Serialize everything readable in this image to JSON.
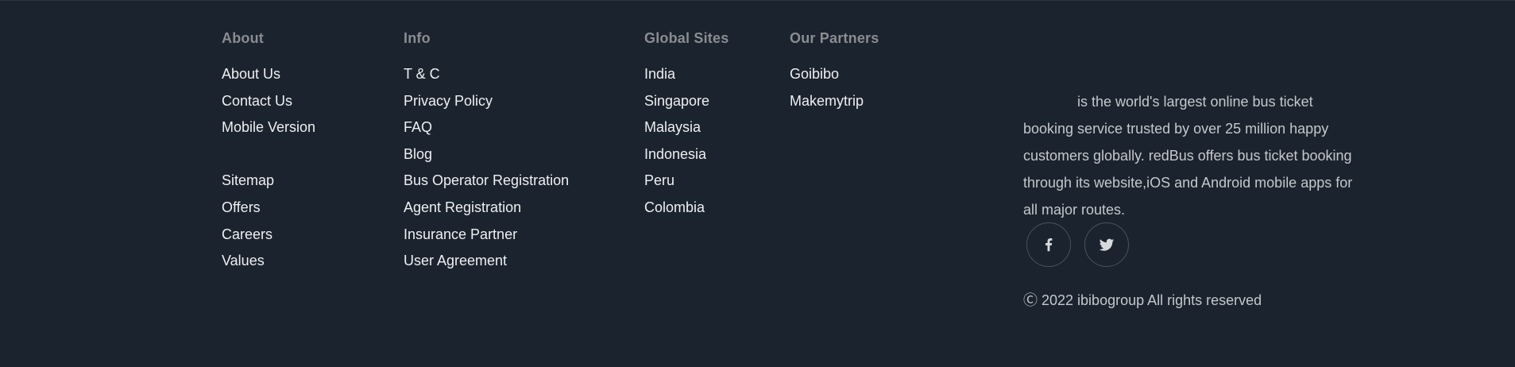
{
  "about": {
    "heading": "About",
    "items": [
      "About Us",
      "Contact Us",
      "Mobile Version",
      "",
      "Sitemap",
      "Offers",
      "Careers",
      "Values"
    ]
  },
  "info": {
    "heading": "Info",
    "items": [
      "T & C",
      "Privacy Policy",
      "FAQ",
      "Blog",
      "Bus Operator Registration",
      "Agent Registration",
      "Insurance Partner",
      "User Agreement"
    ]
  },
  "global_sites": {
    "heading": "Global Sites",
    "items": [
      "India",
      "Singapore",
      "Malaysia",
      "Indonesia",
      "Peru",
      "Colombia"
    ]
  },
  "partners": {
    "heading": "Our Partners",
    "items": [
      "Goibibo",
      "Makemytrip"
    ]
  },
  "description": "is the world's largest online bus ticket booking service trusted by over 25 million happy customers globally. redBus offers bus ticket booking through its website,iOS and Android mobile apps for all major routes.",
  "copyright": "Ⓒ 2022 ibibogroup All rights reserved",
  "social": {
    "facebook_icon": "facebook-icon",
    "twitter_icon": "twitter-icon"
  }
}
